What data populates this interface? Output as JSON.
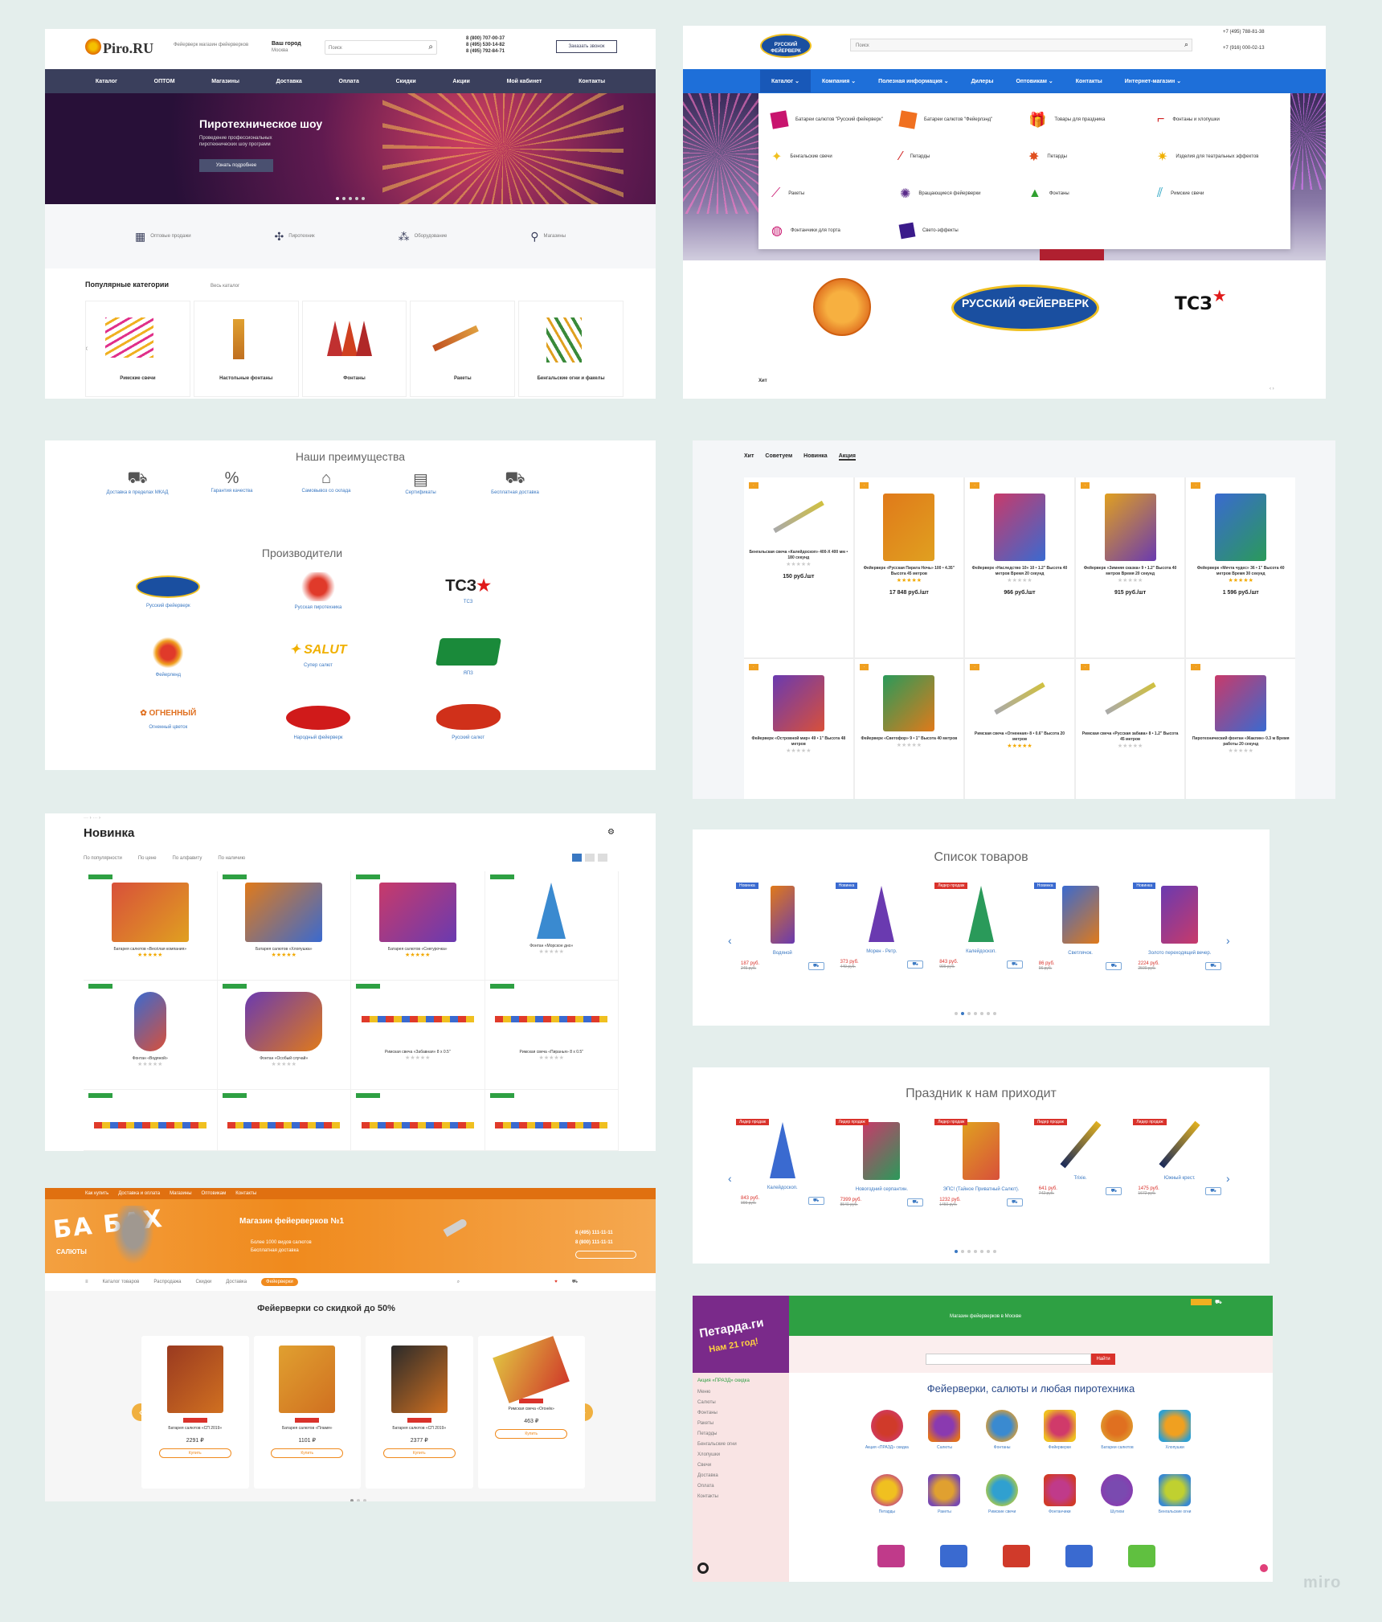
{
  "piro": {
    "logo": "Piro.RU",
    "tagline": "Фейерверк магазин фейерверков",
    "city_label": "Ваш город",
    "city": "Москва",
    "search_placeholder": "Поиск",
    "phones": [
      "8 (800) 707-00-37",
      "8 (495) 530-14-82",
      "8 (495) 792-84-71"
    ],
    "callback": "Заказать звонок",
    "nav": [
      "Каталог",
      "ОПТОМ",
      "Магазины",
      "Доставка",
      "Оплата",
      "Скидки",
      "Акции",
      "Мой кабинет",
      "Контакты"
    ],
    "hero_title": "Пиротехническое шоу",
    "hero_sub": "Проведение профессиональных пиротехнических шоу программ",
    "hero_btn": "Узнать подробнее",
    "features": [
      "Оптовые продажи",
      "Пиротехник",
      "Оборудование",
      "Магазины"
    ],
    "popular_title": "Популярные категории",
    "all_catalog": "Весь каталог",
    "categories": [
      "Римские свечи",
      "Настольные фонтаны",
      "Фонтаны",
      "Ракеты",
      "Бенгальские огни и факелы"
    ]
  },
  "rf": {
    "logo": "РУССКИЙ ФЕЙЕРВЕРК",
    "search_placeholder": "Поиск",
    "phones": [
      "+7 (495) 788-81-38",
      "+7 (916) 000-02-13"
    ],
    "nav": [
      "Каталог",
      "Компания",
      "Полезная информация",
      "Дилеры",
      "Оптовикам",
      "Контакты",
      "Интернет-магазин"
    ],
    "menu": [
      "Батареи салютов \"Русский фейерверк\"",
      "Батареи салютов \"Фейерлэнд\"",
      "Товары для праздника",
      "Фонтаны и хлопушки",
      "Бенгальские свечи",
      "Петарды",
      "Петарды",
      "Изделия для театральных эффектов",
      "Ракеты",
      "Вращающиеся фейерверки",
      "Фонтаны",
      "Римские свечи",
      "Фонтанчики для торта",
      "Свето-эффекты"
    ],
    "brand_tcz": "ТСЗ",
    "bottom_tab": "Хит"
  },
  "adv": {
    "title": "Наши преимущества",
    "items": [
      "Доставка в пределах МКАД",
      "Гарантия качества",
      "Самовывоз со склада",
      "Сертификаты",
      "Бесплатная доставка"
    ],
    "mfr_title": "Производители",
    "mfrs": [
      "Русский фейерверк",
      "Русская пиротехника",
      "ТСЗ",
      "Фейерленд",
      "Супер салют",
      "ЯПЗ",
      "Огненный цветок",
      "Народный фейерверк",
      "Русский салют"
    ]
  },
  "promo": {
    "tabs": [
      "Хит",
      "Советуем",
      "Новинка",
      "Акция"
    ],
    "products": [
      {
        "name": "Бенгальская свеча «Калейдоскоп» 400-Х 400 мм • 180 секунд",
        "price": "150 руб./шт"
      },
      {
        "name": "Фейерверк «Русская Пирата Ночь» 100 • 4.35\" Высота 45 метров",
        "price": "17 848 руб./шт"
      },
      {
        "name": "Фейерверк «Наследство 10» 10 • 1.2\" Высота 40 метров Время 20 секунд",
        "price": "966 руб./шт"
      },
      {
        "name": "Фейерверк «Зимняя сказка» 9 • 1.2\" Высота 40 метров Время 20 секунд",
        "price": "915 руб./шт"
      },
      {
        "name": "Фейерверк «Мечта чудес» 36 • 1\" Высота 40 метров Время 30 секунд",
        "price": "1 596 руб./шт"
      },
      {
        "name": "Фейерверк «Островной мир» 49 • 1\" Высота 48 метров",
        "price": ""
      },
      {
        "name": "Фейерверк «Светофор» 9 • 1\" Высота 40 метров",
        "price": ""
      },
      {
        "name": "Римская свеча «Огненная» 8 • 0.6\" Высота 20 метров",
        "price": ""
      },
      {
        "name": "Римская свеча «Русская забава» 8 • 1.2\" Высота 45 метров",
        "price": ""
      },
      {
        "name": "Пиротехнический фонтан «Жаклин» 0.3 м Время работы 20 секунд",
        "price": ""
      }
    ]
  },
  "novinka": {
    "title": "Новинка",
    "filters": [
      "По популярности",
      "По цене",
      "По алфавиту",
      "По наличию"
    ],
    "products": [
      "Батарея салютов «Весёлая компания»",
      "Батарея салютов «Хлопушка»",
      "Батарея салютов «Снегурочка»",
      "Фонтан «Морское дно»",
      "Фонтан «Водяной»",
      "Фонтан «Особый случай»",
      "Римская свеча «Забавная» 8 х 0.5\"",
      "Римская свеча «Пиранья» 8 х 0.5\""
    ]
  },
  "spisok": {
    "title": "Список товаров",
    "products": [
      {
        "name": "Водяной",
        "price": "187 руб.",
        "old": "245 руб.",
        "badge": "Новинка"
      },
      {
        "name": "Морен - Ретр.",
        "price": "373 руб.",
        "old": "449 руб.",
        "badge": "Новинка"
      },
      {
        "name": "Калейдоскоп.",
        "price": "843 руб.",
        "old": "999 руб.",
        "badge": "Лидер продаж"
      },
      {
        "name": "Светлячок.",
        "price": "86 руб.",
        "old": "96 руб.",
        "badge": "Новинка"
      },
      {
        "name": "Золото переходящий вечер.",
        "price": "2224 руб.",
        "old": "2500 руб.",
        "badge": "Новинка"
      }
    ]
  },
  "prazdnik": {
    "title": "Праздник к нам приходит",
    "products": [
      {
        "name": "Калейдоскоп.",
        "price": "843 руб.",
        "old": "999 руб.",
        "badge": "Лидер продаж"
      },
      {
        "name": "Новогодний серпантин.",
        "price": "7399 руб.",
        "old": "8540 руб.",
        "badge": "Лидер продаж"
      },
      {
        "name": "ЭПС! (Тайное Приватный Салют).",
        "price": "1232 руб.",
        "old": "1450 руб.",
        "badge": "Лидер продаж"
      },
      {
        "name": "Trixie.",
        "price": "641 руб.",
        "old": "742 руб.",
        "badge": "Лидер продаж"
      },
      {
        "name": "Южный крест.",
        "price": "1475 руб.",
        "old": "1672 руб.",
        "badge": "Лидер продаж"
      }
    ]
  },
  "babah": {
    "topbar": [
      "Как купить",
      "Доставка и оплата",
      "Магазины",
      "Оптовикам",
      "Контакты"
    ],
    "logo": "БА БАХ",
    "logo_sub": "САЛЮТЫ",
    "hero_title": "Магазин фейерверков №1",
    "hero_lines": [
      "Более 1000 видов салютов",
      "Бесплатная доставка"
    ],
    "phones": [
      "8 (495) 111-11-11",
      "8 (800) 111-11-11"
    ],
    "nav": [
      "Каталог товаров",
      "Распродажа",
      "Скидки",
      "Доставка",
      "Фейерверки"
    ],
    "section_title": "Фейерверки со скидкой до 50%",
    "products": [
      {
        "name": "Батарея салютов «СП 2019»",
        "price": "2291 ₽"
      },
      {
        "name": "Батарея салютов «Пламя»",
        "price": "1101 ₽"
      },
      {
        "name": "Батарея салютов «СП 2019»",
        "price": "2377 ₽"
      },
      {
        "name": "Римская свеча «Огонёк»",
        "price": "463 ₽"
      }
    ],
    "buy": "Купить"
  },
  "petarda": {
    "logo": "Петарда.ги",
    "logo_sub": "Нам 21 год!",
    "header_text": "Магазин фейерверков в Москве",
    "main_title": "Фейерверки, салюты и любая пиротехника",
    "search_btn": "Найти",
    "side": [
      "Акция «ПРАЗД» скидка",
      "Меню",
      "Салюты",
      "Фонтаны",
      "Ракеты",
      "Петарды",
      "Бенгальские огни",
      "Хлопушки",
      "Свечи",
      "Доставка",
      "Оплата",
      "Контакты"
    ],
    "tiles": [
      "Акция «ПРАЗД» скидка",
      "Салюты",
      "Фонтаны",
      "Фейерверки",
      "Батареи салютов",
      "Хлопушки",
      "Петарды",
      "Ракеты",
      "Римские свечи",
      "Фонтанчики",
      "Шутихи",
      "Бенгальские огни"
    ]
  },
  "watermark": "miro",
  "colors": {
    "canvas": "#e4eeec",
    "piro_nav": "#3a3f5c",
    "rf_blue": "#1e6fd9",
    "babah_orange": "#f08a1d",
    "petarda_green": "#2ea043",
    "petarda_purple": "#7a2a8a",
    "link_blue": "#3a78c2",
    "sale_red": "#d9322b"
  }
}
